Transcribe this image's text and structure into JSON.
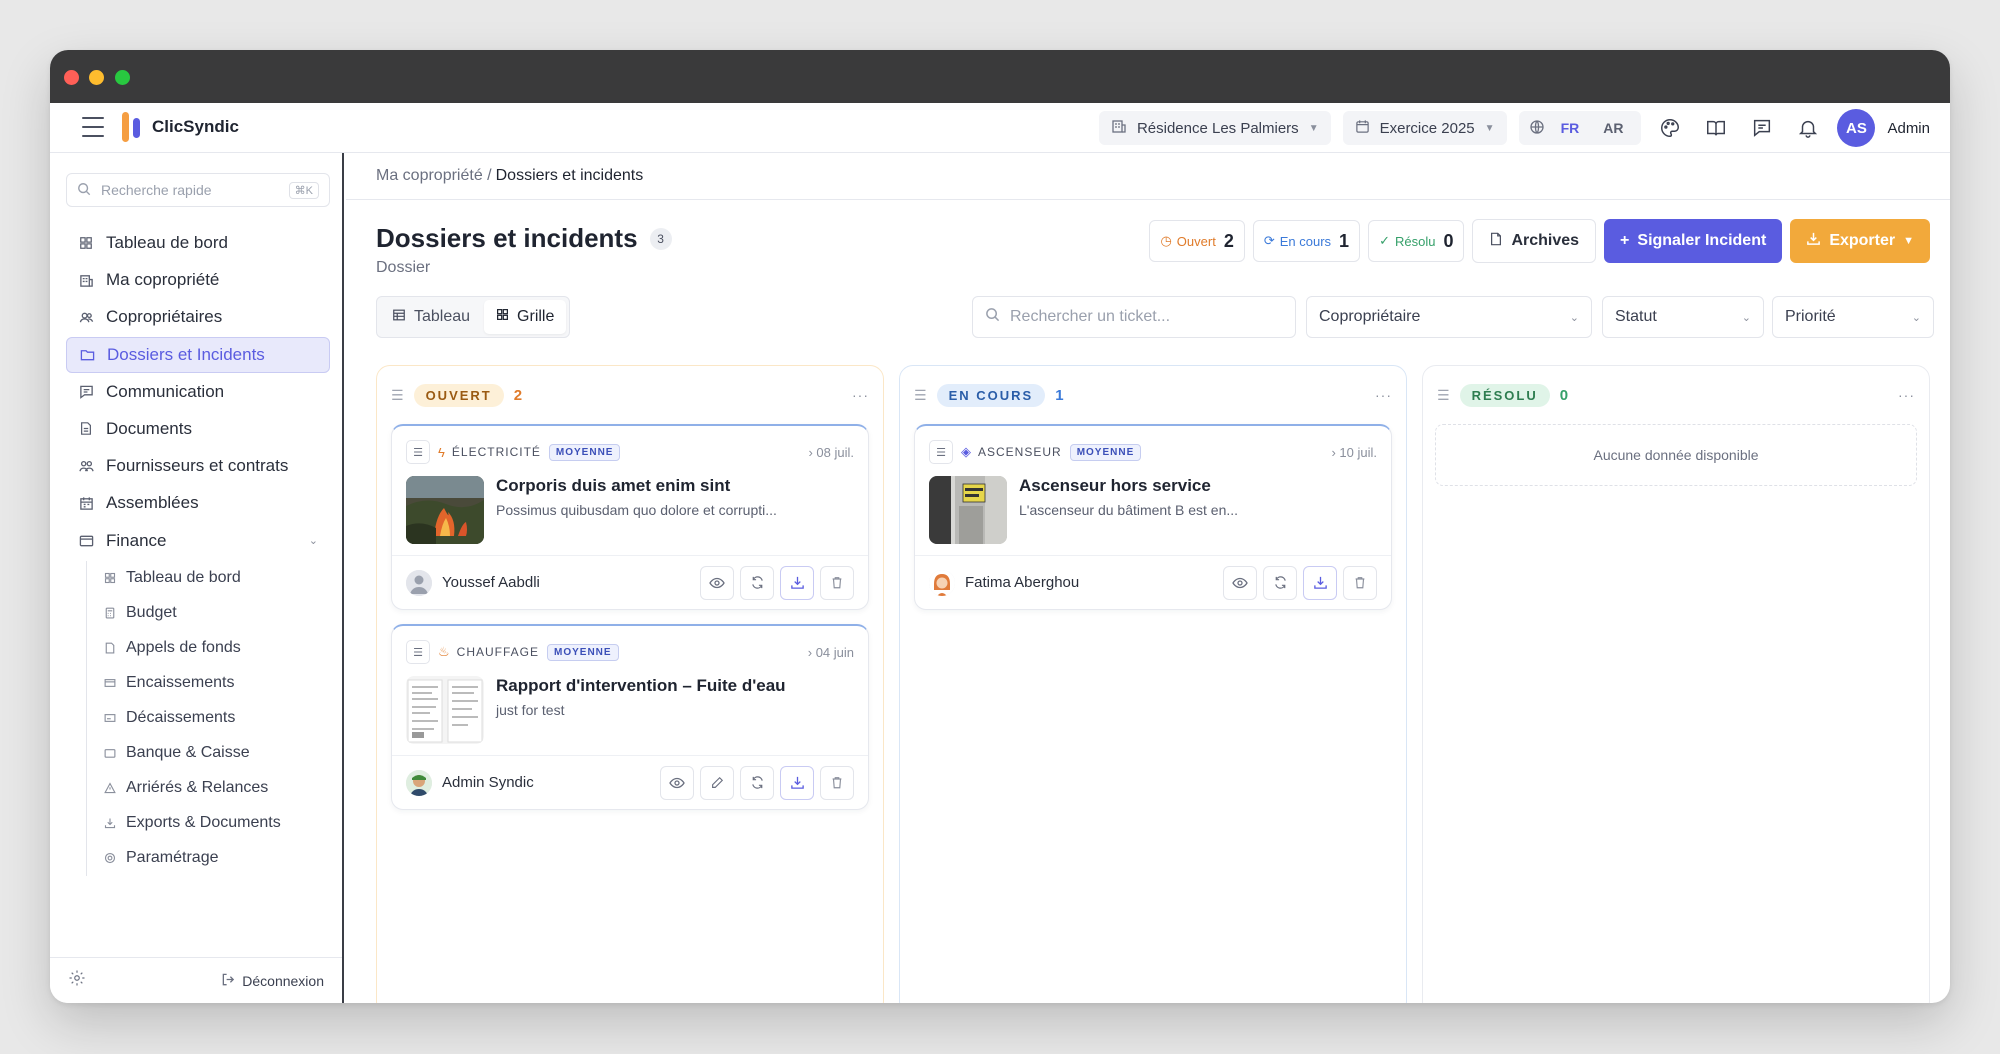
{
  "app": {
    "name": "ClicSyndic"
  },
  "topbar": {
    "residence": "Résidence Les Palmiers",
    "exercice": "Exercice 2025",
    "lang_fr": "FR",
    "lang_ar": "AR",
    "user_initials": "AS",
    "user_label": "Admin"
  },
  "sidebar": {
    "search_placeholder": "Recherche rapide",
    "search_kbd": "⌘K",
    "items": [
      {
        "label": "Tableau de bord",
        "icon": "grid-icon"
      },
      {
        "label": "Ma copropriété",
        "icon": "building-icon"
      },
      {
        "label": "Copropriétaires",
        "icon": "users-icon"
      },
      {
        "label": "Dossiers et Incidents",
        "icon": "folder-icon",
        "active": true
      },
      {
        "label": "Communication",
        "icon": "message-icon"
      },
      {
        "label": "Documents",
        "icon": "document-icon"
      },
      {
        "label": "Fournisseurs et contrats",
        "icon": "handshake-icon"
      },
      {
        "label": "Assemblées",
        "icon": "calendar-icon"
      },
      {
        "label": "Finance",
        "icon": "wallet-icon"
      }
    ],
    "finance_sub": [
      "Tableau de bord",
      "Budget",
      "Appels de fonds",
      "Encaissements",
      "Décaissements",
      "Banque & Caisse",
      "Arriérés & Relances",
      "Exports & Documents",
      "Paramétrage"
    ],
    "logout": "Déconnexion"
  },
  "breadcrumb": {
    "parent": "Ma copropriété /",
    "current": "Dossiers et incidents"
  },
  "page": {
    "title": "Dossiers et incidents",
    "count": "3",
    "subtitle": "Dossier"
  },
  "stats": {
    "open_label": "Ouvert",
    "open_count": "2",
    "prog_label": "En cours",
    "prog_count": "1",
    "res_label": "Résolu",
    "res_count": "0"
  },
  "buttons": {
    "archives": "Archives",
    "report": "Signaler Incident",
    "export": "Exporter"
  },
  "views": {
    "table": "Tableau",
    "grid": "Grille"
  },
  "filters": {
    "search_placeholder": "Rechercher un ticket...",
    "owner": "Copropriétaire",
    "status": "Statut",
    "priority": "Priorité"
  },
  "columns": {
    "open": {
      "label": "OUVERT",
      "count": "2"
    },
    "prog": {
      "label": "EN COURS",
      "count": "1"
    },
    "res": {
      "label": "RÉSOLU",
      "count": "0",
      "empty": "Aucune donnée disponible"
    }
  },
  "cards": [
    {
      "category": "ÉLECTRICITÉ",
      "priority": "MOYENNE",
      "date": "› 08 juil.",
      "title": "Corporis duis amet enim sint",
      "desc": "Possimus quibusdam quo dolore et corrupti...",
      "person": "Youssef Aabdli"
    },
    {
      "category": "CHAUFFAGE",
      "priority": "MOYENNE",
      "date": "› 04 juin",
      "title": "Rapport d'intervention – Fuite d'eau",
      "desc": "just for test",
      "person": "Admin Syndic"
    },
    {
      "category": "ASCENSEUR",
      "priority": "MOYENNE",
      "date": "› 10 juil.",
      "title": "Ascenseur hors service",
      "desc": "L'ascenseur du bâtiment B est en...",
      "person": "Fatima Aberghou"
    }
  ]
}
